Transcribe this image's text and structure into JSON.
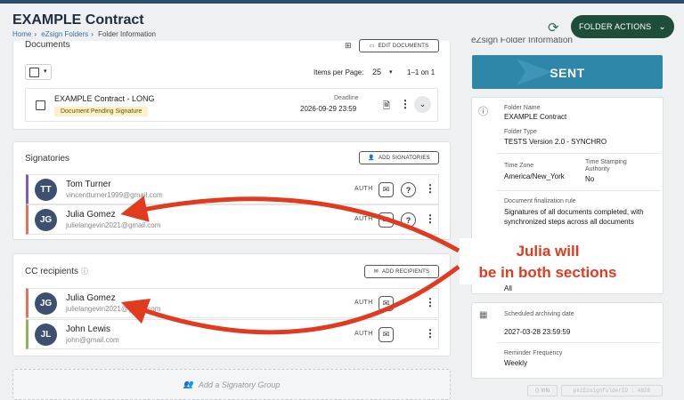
{
  "header": {
    "title": "EXAMPLE Contract",
    "breadcrumb": [
      "Home",
      "eZsign Folders",
      "Folder Information"
    ],
    "folder_actions_label": "FOLDER ACTIONS"
  },
  "documents": {
    "title": "Documents",
    "edit_label": "EDIT DOCUMENTS",
    "items_per_page_label": "Items per Page:",
    "items_per_page_value": "25",
    "pagination": "1–1 on 1",
    "doc_name": "EXAMPLE Contract - LONG",
    "doc_status": "Document Pending Signature",
    "deadline_label": "Deadline",
    "deadline_value": "2026-09-29 23:59"
  },
  "signatories": {
    "title": "Signatories",
    "add_label": "ADD SIGNATORIES",
    "people": [
      {
        "initials": "TT",
        "name": "Tom Turner",
        "email": "vincentturner1999@gmail.com",
        "auth": "AUTH"
      },
      {
        "initials": "JG",
        "name": "Julia Gomez",
        "email": "julielangevin2021@gmail.com",
        "auth": "AUTH"
      }
    ]
  },
  "cc": {
    "title": "CC recipients",
    "add_label": "ADD RECIPIENTS",
    "people": [
      {
        "initials": "JG",
        "name": "Julia Gomez",
        "email": "julielangevin2021@gmail.com",
        "auth": "AUTH"
      },
      {
        "initials": "JL",
        "name": "John Lewis",
        "email": "john@gmail.com",
        "auth": "AUTH"
      }
    ]
  },
  "signatory_group": {
    "label": "Add a Signatory Group"
  },
  "folder_info": {
    "title": "eZsign Folder Information",
    "status": "SENT",
    "folder_name_label": "Folder Name",
    "folder_name": "EXAMPLE Contract",
    "folder_type_label": "Folder Type",
    "folder_type": "TESTS Version 2.0 - SYNCHRO",
    "timezone_label": "Time Zone",
    "timezone": "America/New_York",
    "stamping_label": "Time Stamping Authority",
    "stamping": "No",
    "finalization_label": "Document finalization rule",
    "finalization": "Signatures of all documents completed, with synchronized steps across all documents",
    "extra_value": "All",
    "archiving_label": "Scheduled archiving date",
    "archiving": "2027-03-28 23:59:59",
    "reminder_label": "Reminder Frequency",
    "reminder": "Weekly",
    "info_label": "Info",
    "id_label": "pkiEzsignfolderID : 4826"
  },
  "callout": {
    "line1": "Julia will",
    "line2": "be in both sections"
  },
  "colors": {
    "accent": "#1e4d3a",
    "sent": "#2e86a8",
    "arrow": "#e03b1f",
    "signatory_bar_1": "#7c5cbf",
    "signatory_bar_2": "#e0735a",
    "cc_bar_1": "#e0735a",
    "cc_bar_2": "#8fb35a"
  }
}
